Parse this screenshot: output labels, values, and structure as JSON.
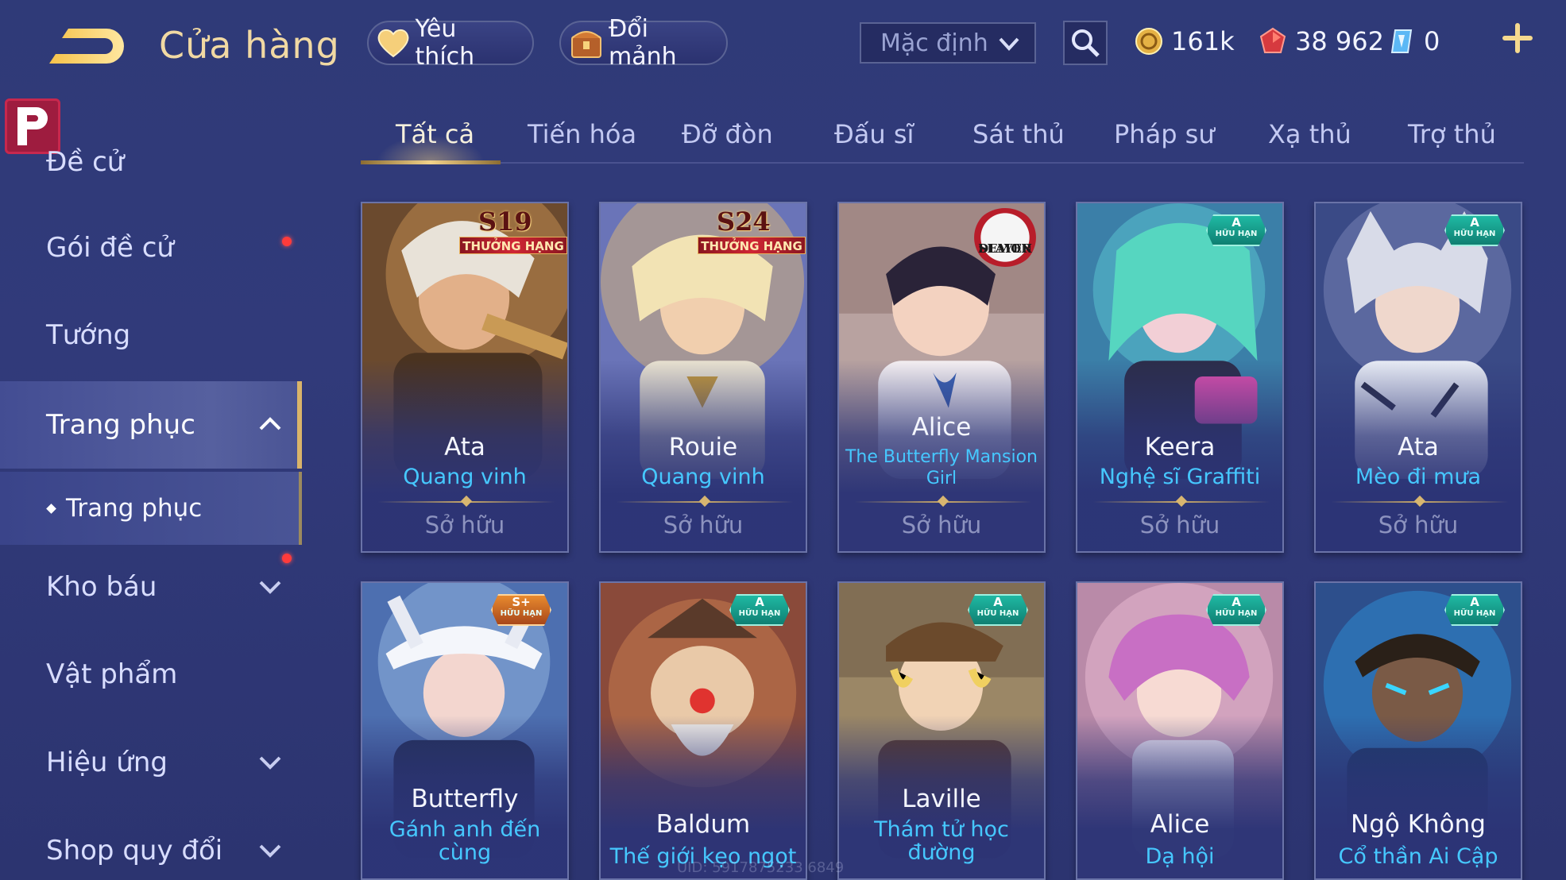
{
  "header": {
    "title": "Cửa hàng",
    "favorite_label": "Yêu thích",
    "exchange_label": "Đổi mảnh",
    "sort": {
      "selected": "Mặc định"
    },
    "currencies": {
      "gold": "161k",
      "vouchers": "38 962",
      "crystals": "0"
    },
    "icons": [
      "back-icon",
      "heart-icon",
      "chest-icon",
      "chevron-down-icon",
      "search-icon",
      "gold-coin-icon",
      "red-voucher-icon",
      "crystal-icon",
      "plus-icon"
    ]
  },
  "sidebar": {
    "items": [
      {
        "label": "Đề cử"
      },
      {
        "label": "Gói đề cử"
      },
      {
        "label": "Tướng"
      },
      {
        "label": "Trang phục"
      },
      {
        "label": "Trang phục"
      },
      {
        "label": "Kho báu"
      },
      {
        "label": "Vật phẩm"
      },
      {
        "label": "Hiệu ứng"
      },
      {
        "label": "Shop quy đổi"
      }
    ]
  },
  "tabs": [
    "Tất cả",
    "Tiến hóa",
    "Đỡ đòn",
    "Đấu sĩ",
    "Sát thủ",
    "Pháp sư",
    "Xạ thủ",
    "Trợ thủ"
  ],
  "badges": {
    "s19": "S19",
    "s24": "S24",
    "ranked": "THƯỞNG HẠNG",
    "a": "A",
    "splus": "S+",
    "limited": "HỮU HẠN",
    "demon1": "DEMON",
    "demon2": "SLAYER"
  },
  "cards": [
    {
      "hero": "Ata",
      "skin": "Quang vinh",
      "status": "Sở hữu"
    },
    {
      "hero": "Rouie",
      "skin": "Quang vinh",
      "status": "Sở hữu"
    },
    {
      "hero": "Alice",
      "skin": "The Butterfly Mansion Girl",
      "status": "Sở hữu"
    },
    {
      "hero": "Keera",
      "skin": "Nghệ sĩ Graffiti",
      "status": "Sở hữu"
    },
    {
      "hero": "Ata",
      "skin": "Mèo đi mưa",
      "status": "Sở hữu"
    },
    {
      "hero": "Butterfly",
      "skin": "Gánh anh đến cùng"
    },
    {
      "hero": "Baldum",
      "skin": "Thế giới kẹo ngọt"
    },
    {
      "hero": "Laville",
      "skin": "Thám tử học đường"
    },
    {
      "hero": "Alice",
      "skin": "Dạ hội"
    },
    {
      "hero": "Ngộ Không",
      "skin": "Cổ thần Ai Cập"
    }
  ],
  "footer": {
    "uid": "UID: 5917875233 6849"
  },
  "colors": {
    "accent_gold": "#f1d9a3",
    "skin_blue": "#46c8ff",
    "bg": "#2f3a78",
    "notify_red": "#ff3b3b"
  }
}
